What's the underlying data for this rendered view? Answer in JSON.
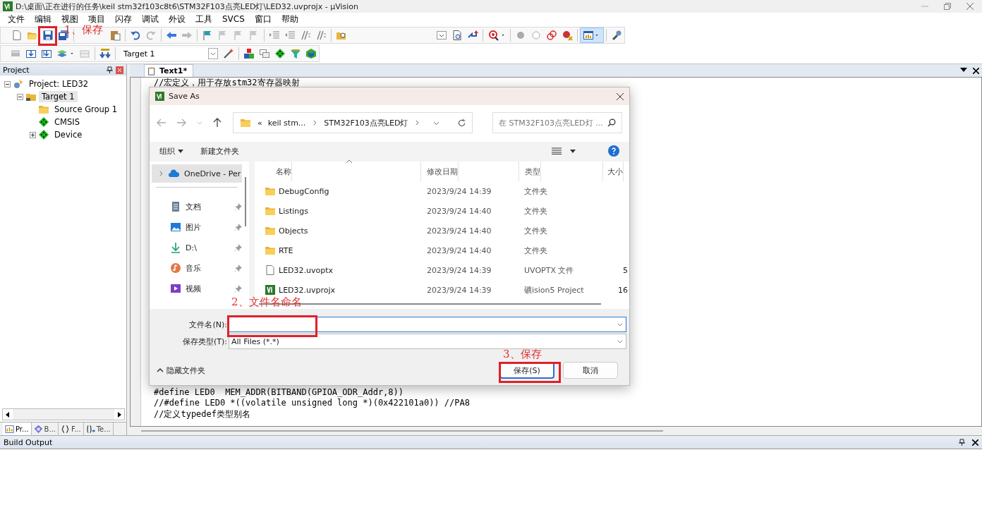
{
  "window": {
    "title": "D:\\桌面\\正在进行的任务\\keil stm32f103c8t6\\STM32F103点亮LED灯\\LED32.uvprojx - µVision"
  },
  "menu": [
    "文件",
    "编辑",
    "视图",
    "项目",
    "闪存",
    "调试",
    "外设",
    "工具",
    "SVCS",
    "窗口",
    "帮助"
  ],
  "toolbar": {
    "target": "Target 1"
  },
  "project_panel": {
    "title": "Project",
    "tree": [
      {
        "label": "Project: LED32",
        "kind": "project",
        "expanded": true,
        "selected": false,
        "children": [
          {
            "label": "Target 1",
            "kind": "target",
            "expanded": true,
            "selected": true,
            "children": [
              {
                "label": "Source Group 1",
                "kind": "group",
                "selected": false
              },
              {
                "label": "CMSIS",
                "kind": "component",
                "selected": false
              },
              {
                "label": "Device",
                "kind": "component",
                "expanded": false,
                "selected": false
              }
            ]
          }
        ]
      }
    ],
    "tabs": [
      {
        "label": "Pr...",
        "kind": "project",
        "selected": true
      },
      {
        "label": "B...",
        "kind": "books",
        "selected": false
      },
      {
        "label": "F...",
        "kind": "functions",
        "selected": false
      },
      {
        "label": "Te...",
        "kind": "templates",
        "selected": false
      }
    ]
  },
  "editor": {
    "tabs": [
      {
        "label": "Text1*",
        "selected": true
      }
    ],
    "code_top": [
      "//宏定义，用于存放stm32寄存器映射"
    ],
    "code_bottom": [
      "#define LED0  MEM_ADDR(BITBAND(GPIOA_ODR_Addr,8))",
      "//#define LED0 *((volatile unsigned long *)(0x422101a0)) //PA8",
      "//定义typedef类型别名"
    ]
  },
  "save_dialog": {
    "title": "Save As",
    "path": [
      "«",
      "keil stm...",
      "STM32F103点亮LED灯"
    ],
    "search": {
      "placeholder": "在 STM32F103点亮LED灯 ..."
    },
    "commands": [
      "组织",
      "新建文件夹"
    ],
    "nav_items": [
      {
        "label": "OneDrive - Per",
        "kind": "cloud",
        "pinned": false,
        "selected": true
      },
      {
        "label": "文档",
        "kind": "documents",
        "pinned": true,
        "selected": false
      },
      {
        "label": "图片",
        "kind": "pictures",
        "pinned": true,
        "selected": false
      },
      {
        "label": "D:\\",
        "kind": "download",
        "pinned": true,
        "selected": false
      },
      {
        "label": "音乐",
        "kind": "music",
        "pinned": true,
        "selected": false
      },
      {
        "label": "视频",
        "kind": "videos",
        "pinned": true,
        "selected": false
      }
    ],
    "columns": [
      "名称",
      "修改日期",
      "类型",
      "大小"
    ],
    "files": [
      {
        "name": "DebugConfig",
        "kind": "folder",
        "modified": "2023/9/24 14:39",
        "type": "文件夹"
      },
      {
        "name": "Listings",
        "kind": "folder",
        "modified": "2023/9/24 14:40",
        "type": "文件夹"
      },
      {
        "name": "Objects",
        "kind": "folder",
        "modified": "2023/9/24 14:40",
        "type": "文件夹"
      },
      {
        "name": "RTE",
        "kind": "folder",
        "modified": "2023/9/24 14:40",
        "type": "文件夹"
      },
      {
        "name": "LED32.uvoptx",
        "kind": "file",
        "modified": "2023/9/24 14:39",
        "type": "UVOPTX 文件",
        "size": "5"
      },
      {
        "name": "LED32.uvprojx",
        "kind": "project",
        "modified": "2023/9/24 14:39",
        "type": "礦ision5 Project",
        "size": "16"
      }
    ],
    "filename": {
      "label": "文件名(N):"
    },
    "filetype": {
      "label": "保存类型(T):",
      "value": "All Files (*.*)"
    },
    "hide_folders": "隐藏文件夹",
    "buttons": [
      {
        "label": "保存(S)",
        "default": true
      },
      {
        "label": "取消",
        "default": false
      }
    ]
  },
  "annotations": [
    {
      "text": "1、保存"
    },
    {
      "text": "2、文件名命名"
    },
    {
      "text": "3、保存"
    }
  ],
  "build_output": {
    "title": "Build Output"
  }
}
